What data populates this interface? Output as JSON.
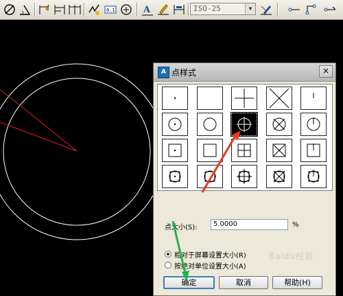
{
  "toolbar": {
    "dim_style_value": "ISO-25",
    "icons": [
      "diameter-dim-icon",
      "angular-dim-icon",
      "quick-dim-icon",
      "baseline-dim-icon",
      "continue-dim-icon",
      "dim-space-icon",
      "tolerance-icon",
      "center-mark-icon",
      "dim-edit-icon",
      "dim-text-edit-icon",
      "dim-update-icon",
      "dimstyle-icon",
      "leader-icon",
      "multileader-icon"
    ]
  },
  "dialog": {
    "title": "点样式",
    "close_label": "×",
    "point_size_label": "点大小(S):",
    "point_size_value": "5.0000",
    "percent_label": "%",
    "radio_screen_label": "相对于屏幕设置大小(R)",
    "radio_absolute_label": "按绝对单位设置大小(A)",
    "radio_selected": "screen",
    "ok_label": "确定",
    "cancel_label": "取消",
    "help_label": "帮助(H)",
    "selected_style_index": 7,
    "styles": [
      "dot",
      "none",
      "plus",
      "cross",
      "tick",
      "circle-dot",
      "circle",
      "circle-plus",
      "circle-cross",
      "circle-tick",
      "square-dot",
      "square",
      "square-plus",
      "square-cross",
      "square-tick",
      "circle-square-dot",
      "circle-square",
      "circle-square-plus",
      "circle-square-cross",
      "circle-square-tick"
    ]
  },
  "colors": {
    "canvas": "#000000",
    "geometry": "#ffffff",
    "red_line": "#e02020",
    "arrow_red": "#e63a1e",
    "arrow_green": "#22b14c"
  },
  "watermark": "Baidu经验"
}
